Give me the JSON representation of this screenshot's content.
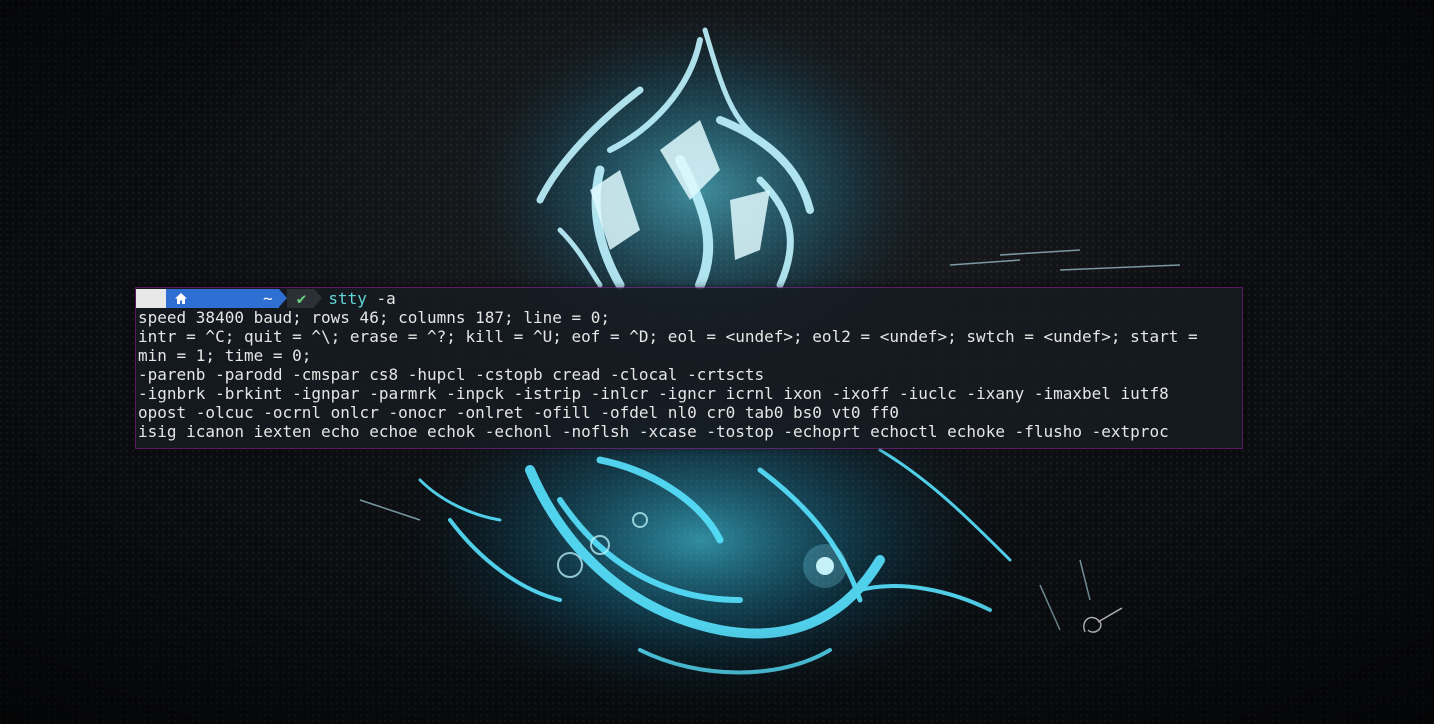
{
  "prompt": {
    "os_icon": "linux-penguin-icon",
    "home_icon": "home-icon",
    "dir": "~",
    "status_icon": "checkmark-icon",
    "status_symbol": "✔",
    "command": "stty",
    "args": "-a"
  },
  "output": [
    "speed 38400 baud; rows 46; columns 187; line = 0;",
    "intr = ^C; quit = ^\\; erase = ^?; kill = ^U; eof = ^D; eol = <undef>; eol2 = <undef>; swtch = <undef>; start =",
    "min = 1; time = 0;",
    "-parenb -parodd -cmspar cs8 -hupcl -cstopb cread -clocal -crtscts",
    "-ignbrk -brkint -ignpar -parmrk -inpck -istrip -inlcr -igncr icrnl ixon -ixoff -iuclc -ixany -imaxbel iutf8",
    "opost -olcuc -ocrnl onlcr -onocr -onlret -ofill -ofdel nl0 cr0 tab0 bs0 vt0 ff0",
    "isig icanon iexten echo echoe echok -echonl -noflsh -xcase -tostop -echoprt echoctl echoke -flusho -extproc"
  ],
  "colors": {
    "prompt_dir_bg": "#2f6fd3",
    "prompt_status_fg": "#67d07d",
    "command_fg": "#5fd7d7",
    "window_border": "#a028aa",
    "dragon_glow": "#39d5ff"
  }
}
